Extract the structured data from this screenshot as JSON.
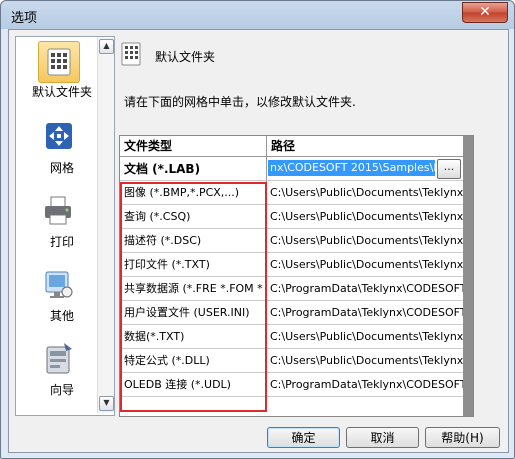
{
  "window": {
    "title": "选项",
    "close_glyph": "✕"
  },
  "sidebar": {
    "items": [
      {
        "label": "默认文件夹",
        "icon": "folder-settings-icon",
        "selected": true
      },
      {
        "label": "网格",
        "icon": "grid-icon"
      },
      {
        "label": "打印",
        "icon": "printer-icon"
      },
      {
        "label": "其他",
        "icon": "other-settings-icon"
      },
      {
        "label": "向导",
        "icon": "wizard-icon"
      }
    ]
  },
  "panel": {
    "title": "默认文件夹",
    "instruction": "请在下面的网格中单击，以修改默认文件夹."
  },
  "grid": {
    "headers": {
      "type": "文件类型",
      "path": "路径"
    },
    "rows": [
      {
        "type": "文档 (*.LAB)",
        "path": "nx\\CODESOFT 2015\\Samples\\Labels"
      },
      {
        "type": "图像 (*.BMP,*.PCX,...)",
        "path": "C:\\Users\\Public\\Documents\\Teklynx\\COD"
      },
      {
        "type": "查询 (*.CSQ)",
        "path": "C:\\Users\\Public\\Documents\\Teklynx\\COD"
      },
      {
        "type": "描述符 (*.DSC)",
        "path": "C:\\Users\\Public\\Documents\\Teklynx\\COD"
      },
      {
        "type": "打印文件 (*.TXT)",
        "path": "C:\\Users\\Public\\Documents\\Teklynx\\COD"
      },
      {
        "type": "共享数据源 (*.FRE *.FOM *",
        "path": "C:\\ProgramData\\Teklynx\\CODESOFT 20"
      },
      {
        "type": "用户设置文件 (USER.INI)",
        "path": "C:\\ProgramData\\Teklynx\\CODESOFT 20"
      },
      {
        "type": "数据(*.TXT)",
        "path": "C:\\Users\\Public\\Documents\\Teklynx\\COD"
      },
      {
        "type": "特定公式 (*.DLL)",
        "path": "C:\\Users\\Public\\Documents\\Teklynx\\COD"
      },
      {
        "type": "OLEDB 连接 (*.UDL)",
        "path": "C:\\ProgramData\\Teklynx\\CODESOFT 20"
      }
    ],
    "browse_label": "..."
  },
  "buttons": {
    "ok": "确定",
    "cancel": "取消",
    "help": "帮助(H)"
  },
  "colors": {
    "selection": "#3399ff",
    "highlight_box": "#e0282f"
  }
}
